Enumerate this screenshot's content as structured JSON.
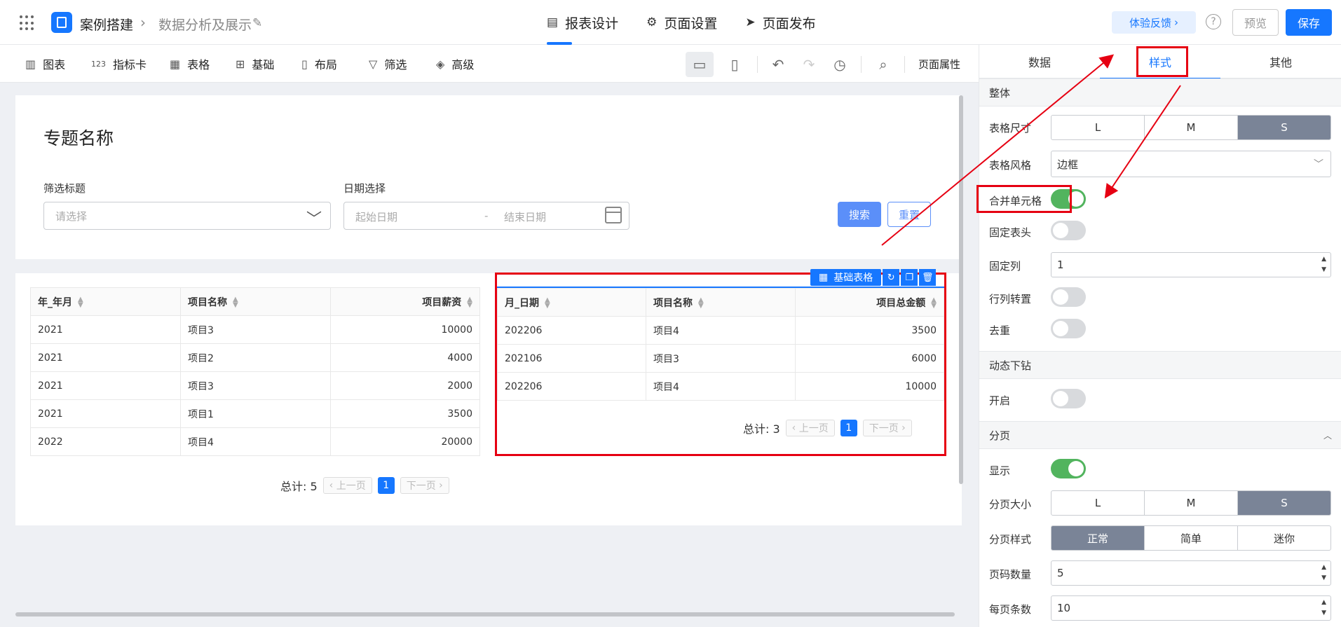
{
  "header": {
    "breadcrumb": [
      "案例搭建",
      "数据分析及展示"
    ],
    "tabs": [
      {
        "label": "报表设计",
        "icon": "report-icon",
        "active": true
      },
      {
        "label": "页面设置",
        "icon": "gear-icon",
        "active": false
      },
      {
        "label": "页面发布",
        "icon": "send-icon",
        "active": false
      }
    ],
    "feedback_label": "体验反馈",
    "help_label": "?",
    "preview_label": "预览",
    "save_label": "保存",
    "accent_color": "#1677ff"
  },
  "toolbar": {
    "items": [
      {
        "label": "图表",
        "icon": "chart-icon"
      },
      {
        "label": "指标卡",
        "icon": "metric-card-icon"
      },
      {
        "label": "表格",
        "icon": "table-icon"
      },
      {
        "label": "基础",
        "icon": "grid-icon"
      },
      {
        "label": "布局",
        "icon": "layout-icon"
      },
      {
        "label": "筛选",
        "icon": "filter-icon"
      },
      {
        "label": "高级",
        "icon": "layers-icon"
      }
    ],
    "indicator_prefix": "123",
    "page_props_label": "页面属性"
  },
  "canvas": {
    "title": "专题名称",
    "filter": {
      "label": "筛选标题",
      "placeholder": "请选择"
    },
    "date": {
      "label": "日期选择",
      "start_placeholder": "起始日期",
      "separator": "-",
      "end_placeholder": "结束日期"
    },
    "search_label": "搜索",
    "reset_label": "重置"
  },
  "table1": {
    "headers": [
      "年_年月",
      "项目名称",
      "项目薪资"
    ],
    "rows": [
      [
        "2021",
        "项目3",
        "10000"
      ],
      [
        "2021",
        "项目2",
        "4000"
      ],
      [
        "2021",
        "项目3",
        "2000"
      ],
      [
        "2021",
        "项目1",
        "3500"
      ],
      [
        "2022",
        "项目4",
        "20000"
      ]
    ],
    "total": "总计: 5",
    "prev": "上一页",
    "page": "1",
    "next": "下一页"
  },
  "table2": {
    "component_label": "基础表格",
    "headers": [
      "月_日期",
      "项目名称",
      "项目总金额"
    ],
    "rows": [
      [
        "202206",
        "项目4",
        "3500"
      ],
      [
        "202106",
        "项目3",
        "6000"
      ],
      [
        "202206",
        "项目4",
        "10000"
      ]
    ],
    "total": "总计: 3",
    "prev": "上一页",
    "page": "1",
    "next": "下一页"
  },
  "panel": {
    "tabs": [
      {
        "label": "数据",
        "active": false
      },
      {
        "label": "样式",
        "active": true
      },
      {
        "label": "其他",
        "active": false
      }
    ],
    "section_overall": "整体",
    "table_size_label": "表格尺寸",
    "table_size_options": [
      "L",
      "M",
      "S"
    ],
    "table_size_selected": "S",
    "table_style_label": "表格风格",
    "table_style_value": "边框",
    "merge_cells_label": "合并单元格",
    "merge_cells_on": true,
    "fixed_header_label": "固定表头",
    "fixed_header_on": false,
    "fixed_col_label": "固定列",
    "fixed_col_value": "1",
    "transpose_label": "行列转置",
    "transpose_on": false,
    "dedupe_label": "去重",
    "dedupe_on": false,
    "section_drill": "动态下钻",
    "drill_enable_label": "开启",
    "drill_enable_on": false,
    "section_paging": "分页",
    "paging_show_label": "显示",
    "paging_show_on": true,
    "page_size_label": "分页大小",
    "page_size_options": [
      "L",
      "M",
      "S"
    ],
    "page_size_selected": "S",
    "page_style_label": "分页样式",
    "page_style_options": [
      "正常",
      "简单",
      "迷你"
    ],
    "page_style_selected": "正常",
    "page_count_label": "页码数量",
    "page_count_value": "5",
    "per_page_label": "每页条数",
    "per_page_value": "10"
  }
}
